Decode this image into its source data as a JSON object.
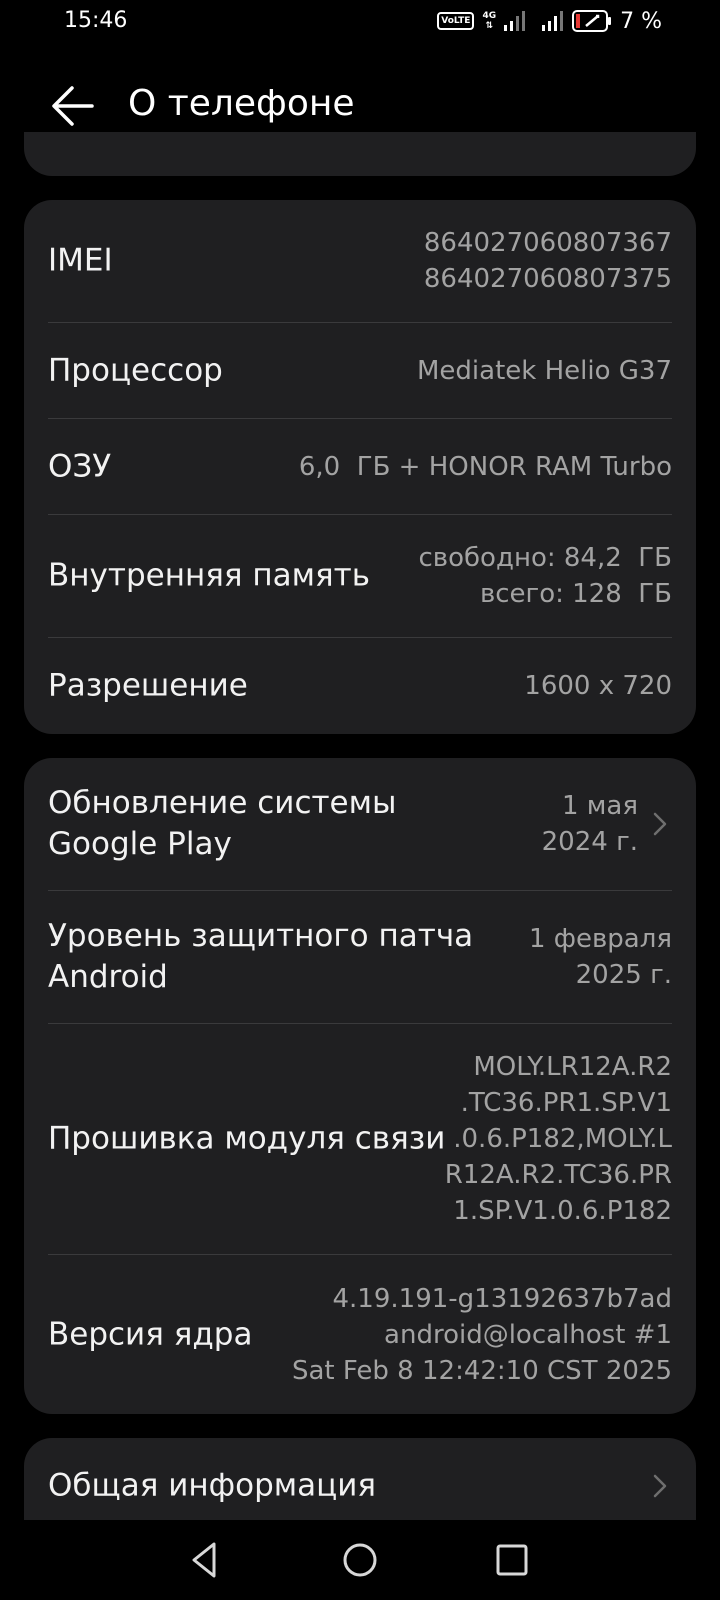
{
  "status": {
    "time": "15:46",
    "volte": "VoLTE",
    "net_type": "4G",
    "battery": "7 %"
  },
  "header": {
    "title": "О телефоне"
  },
  "specs": [
    {
      "label": "IMEI",
      "value": [
        "864027060807367",
        "864027060807375"
      ]
    },
    {
      "label": "Процессор",
      "value": [
        "Mediatek Helio G37"
      ]
    },
    {
      "label": "ОЗУ",
      "value": [
        "6,0  ГБ + HONOR RAM Turbo"
      ]
    },
    {
      "label": "Внутренняя память",
      "value": [
        "свободно: 84,2  ГБ",
        "всего: 128  ГБ"
      ]
    },
    {
      "label": "Разрешение",
      "value": [
        "1600 x 720"
      ]
    }
  ],
  "software": [
    {
      "label": [
        "Обновление системы",
        "Google Play"
      ],
      "value": [
        "1 мая",
        "2024 г."
      ]
    },
    {
      "label": [
        "Уровень защитного патча",
        "Android"
      ],
      "value": [
        "1 февраля",
        "2025 г."
      ]
    },
    {
      "label": [
        "Прошивка модуля связи"
      ],
      "value": [
        "MOLY.LR12A.R2",
        ".TC36.PR1.SP.V1",
        ".0.6.P182,MOLY.L",
        "R12A.R2.TC36.PR",
        "1.SP.V1.0.6.P182"
      ]
    },
    {
      "label": [
        "Версия ядра"
      ],
      "value": [
        "4.19.191-g13192637b7ad",
        "android@localhost #1",
        "Sat Feb 8 12:42:10 CST 2025"
      ]
    }
  ],
  "general": {
    "label": "Общая информация"
  },
  "colors": {
    "background": "#000000",
    "card": "#1f1f21",
    "value_text": "#a3a3a3",
    "divider": "#3a3a3c"
  }
}
